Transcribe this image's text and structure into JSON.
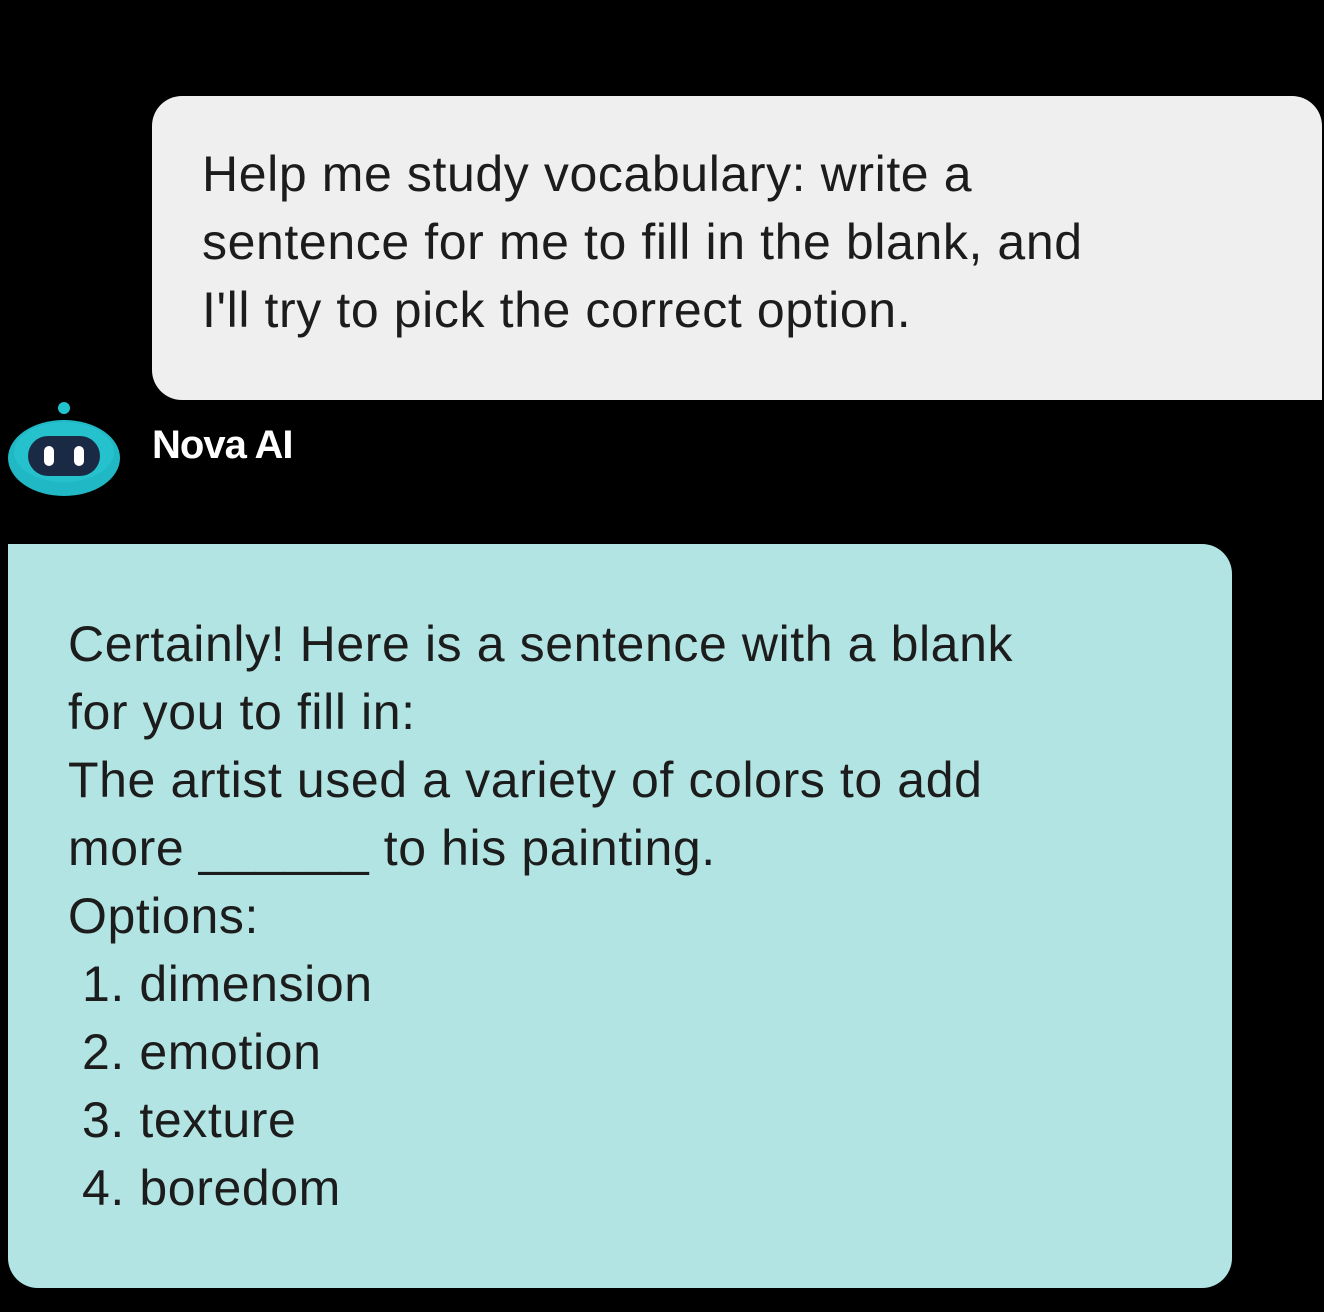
{
  "user_message": {
    "text": "Help me study vocabulary: write a\nsentence for me to fill in the blank, and\nI'll try to pick the correct option."
  },
  "assistant": {
    "name": "Nova AI",
    "avatar_icon": "robot-icon",
    "avatar_color": "#1fb8c4",
    "bubble_color": "#b2e4e3",
    "lines": [
      "Certainly! Here is a sentence with a blank",
      "for you to fill in:",
      "The artist used a variety of colors to add",
      "more ______ to his painting.",
      "Options:"
    ],
    "options": [
      "1. dimension",
      "2. emotion",
      "3. texture",
      "4. boredom"
    ]
  }
}
